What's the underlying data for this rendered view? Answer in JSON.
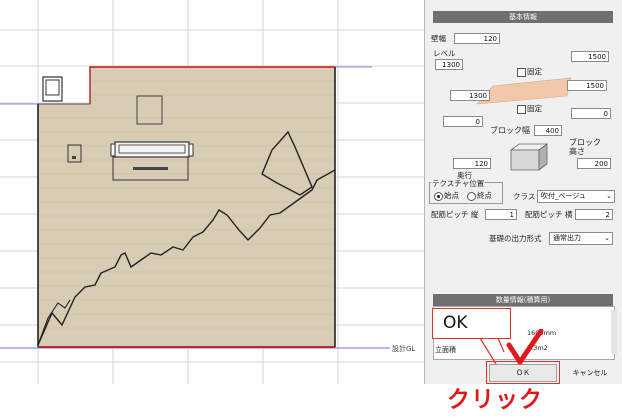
{
  "panel": {
    "basic_header": "基本情報",
    "width_label": "壁幅",
    "width_value": "120",
    "level_label": "レベル",
    "level_left_value": "1300",
    "level_right_value": "1500",
    "fixed_label_top": "固定",
    "mid_right_value": "1500",
    "mid_left_value": "1300",
    "fixed_label_bottom": "固定",
    "zero_left_value": "0",
    "zero_right_value": "0",
    "block_width_label": "ブロック幅",
    "block_width_value": "400",
    "block_height_label": "ブロック\n高さ",
    "block_height_value": "200",
    "depth_value": "120",
    "depth_label": "奥行",
    "texture_label": "テクスチャ位置",
    "radio_start_label": "始点",
    "radio_end_label": "終点",
    "class_label": "クラス",
    "class_value": "吹付_ベージュ",
    "pitch_v_label": "配筋ピッチ 縦",
    "pitch_v_value": "1",
    "pitch_h_label": "配筋ピッチ 横",
    "pitch_h_value": "2",
    "foundation_label": "基礎の出力形式",
    "foundation_value": "通常出力",
    "quantity_header": "数量情報(積算用)",
    "qty_value_1": "1600mm",
    "qty_row_label": "立面積",
    "qty_value_2": "2.3m2",
    "ok_button": "ＯＫ",
    "cancel_button": "キャンセル"
  },
  "drawing": {
    "gl_label": "設計GL"
  },
  "annotation": {
    "ok_callout": "OK",
    "click_label": "クリック"
  },
  "colors": {
    "wall_fill": "#d8ccb4",
    "outline_red": "#c01818",
    "gl_line": "#8c8cff",
    "callout_red": "#e03030",
    "block_preview": "#f2c8a8"
  }
}
